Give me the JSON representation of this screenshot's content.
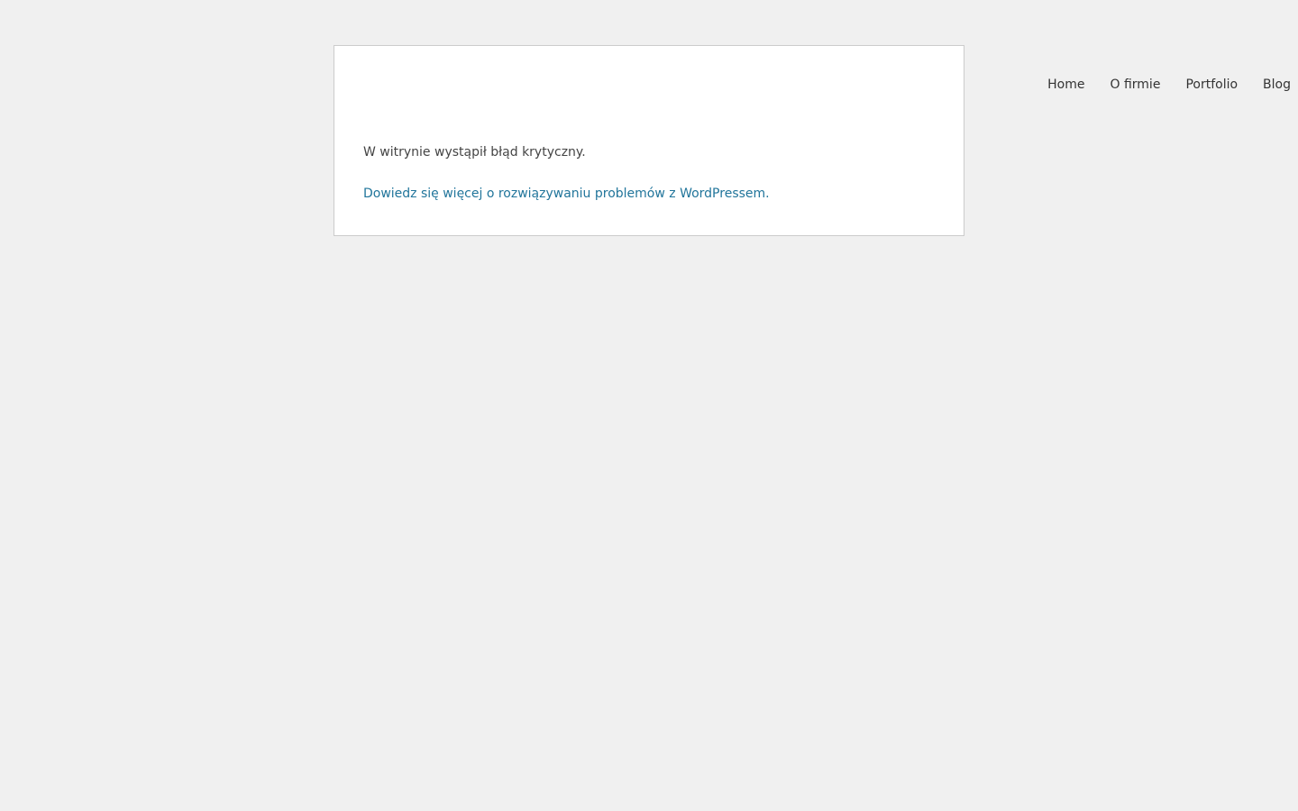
{
  "error": {
    "message": "W witrynie wystąpił błąd krytyczny.",
    "help_link": "Dowiedz się więcej o rozwiązywaniu problemów z WordPressem."
  },
  "nav": {
    "items": [
      {
        "label": "Home"
      },
      {
        "label": "O firmie"
      },
      {
        "label": "Portfolio"
      },
      {
        "label": "Blog"
      }
    ]
  },
  "colors": {
    "background": "#f0f0f0",
    "box_background": "#ffffff",
    "box_border": "#cccccc",
    "text": "#444444",
    "link": "#21759b",
    "nav_text": "#333333"
  }
}
